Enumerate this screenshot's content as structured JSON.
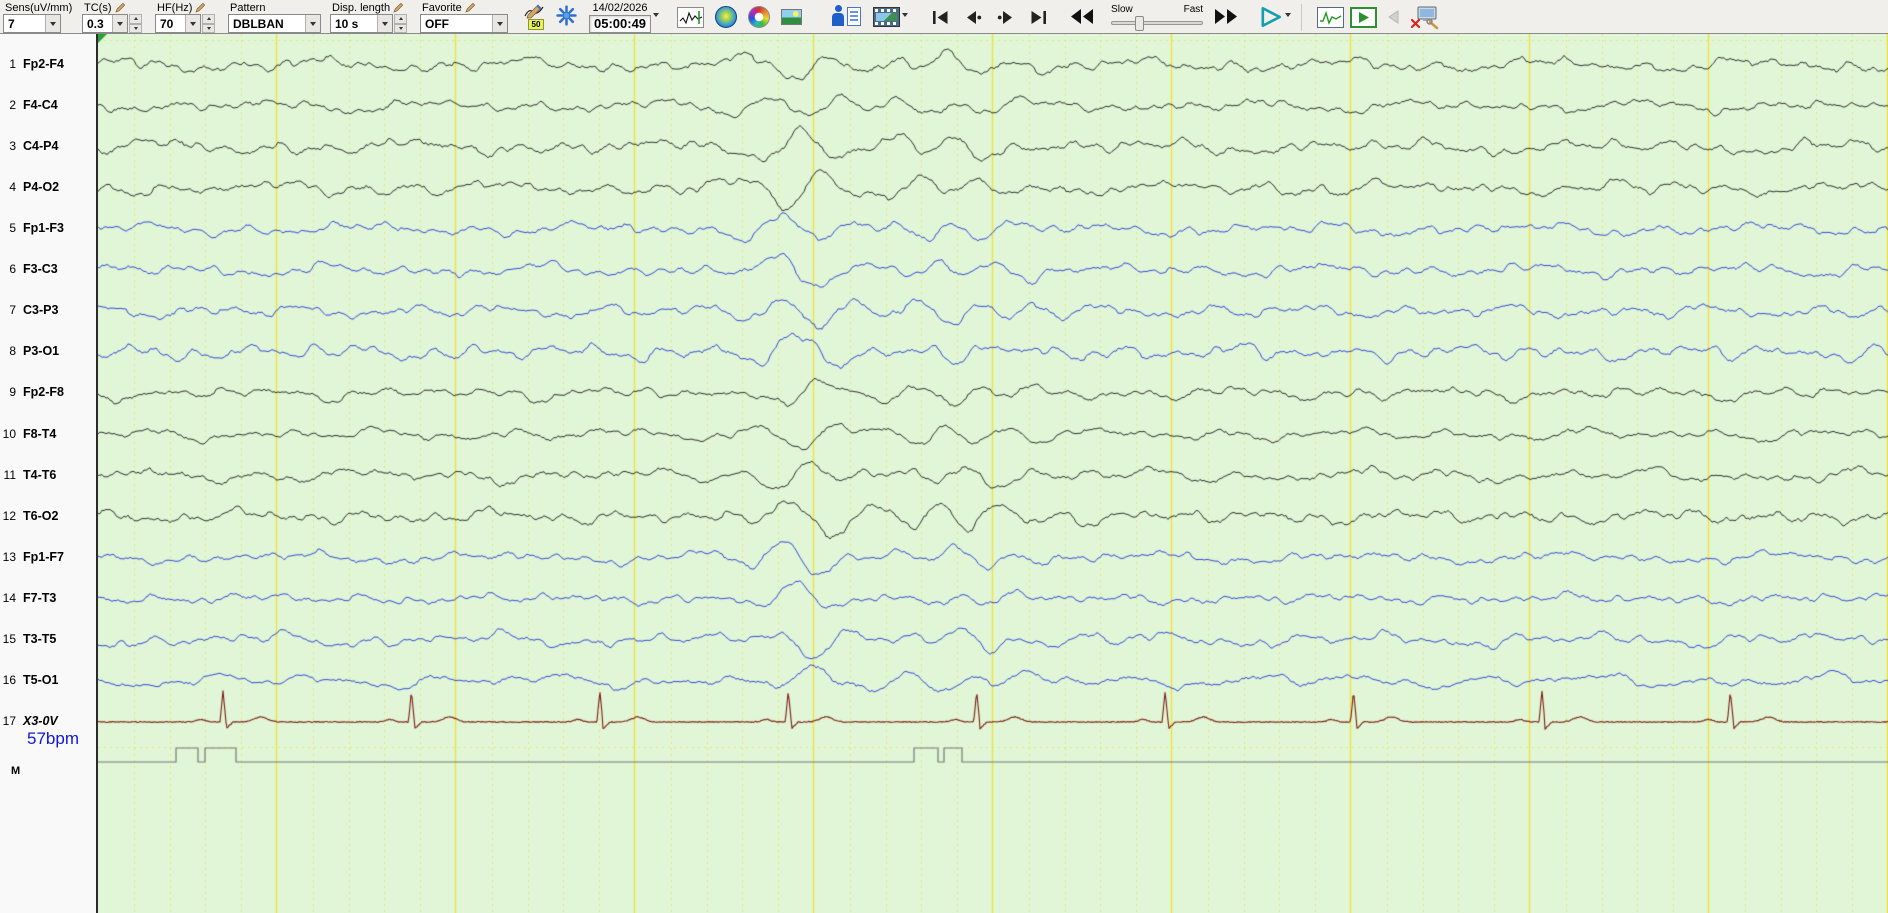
{
  "toolbar": {
    "sens": {
      "label": "Sens(uV/mm)",
      "value": "7"
    },
    "tc": {
      "label": "TC(s)",
      "value": "0.3"
    },
    "hf": {
      "label": "HF(Hz)",
      "value": "70"
    },
    "pattern": {
      "label": "Pattern",
      "value": "DBLBAN"
    },
    "disp": {
      "label": "Disp. length",
      "value": "10 s"
    },
    "favorite": {
      "label": "Favorite",
      "value": "OFF"
    },
    "notch_badge": "50",
    "date": "14/02/2026",
    "time": "05:00:49",
    "slow": "Slow",
    "fast": "Fast"
  },
  "display": {
    "seconds": 10,
    "bg": "#e0f6d7",
    "grid_major": "#eee23c",
    "grid_minor": "#e9e375",
    "eeg_black": "#1a1a1a",
    "eeg_blue": "#2336d6",
    "ecg_color": "#7e1c10",
    "marker_color": "#777777",
    "heart_rate_bpm": 57
  },
  "channels": [
    {
      "num": "1",
      "label": "Fp2-F4",
      "pen": "black",
      "amp": 1.0,
      "burst": 0.9
    },
    {
      "num": "2",
      "label": "F4-C4",
      "pen": "black",
      "amp": 0.9,
      "burst": 0.85
    },
    {
      "num": "3",
      "label": "C4-P4",
      "pen": "black",
      "amp": 1.0,
      "burst": 1.3
    },
    {
      "num": "4",
      "label": "P4-O2",
      "pen": "black",
      "amp": 1.0,
      "burst": 1.5
    },
    {
      "num": "5",
      "label": "Fp1-F3",
      "pen": "blue",
      "amp": 0.9,
      "burst": 1.0
    },
    {
      "num": "6",
      "label": "F3-C3",
      "pen": "blue",
      "amp": 0.85,
      "burst": 1.1
    },
    {
      "num": "7",
      "label": "C3-P3",
      "pen": "blue",
      "amp": 0.9,
      "burst": 1.2
    },
    {
      "num": "8",
      "label": "P3-O1",
      "pen": "blue",
      "amp": 1.0,
      "burst": 1.2
    },
    {
      "num": "9",
      "label": "Fp2-F8",
      "pen": "black",
      "amp": 0.9,
      "burst": 1.0
    },
    {
      "num": "10",
      "label": "F8-T4",
      "pen": "black",
      "amp": 0.85,
      "burst": 1.0
    },
    {
      "num": "11",
      "label": "T4-T6",
      "pen": "black",
      "amp": 0.9,
      "burst": 1.1
    },
    {
      "num": "12",
      "label": "T6-O2",
      "pen": "black",
      "amp": 1.0,
      "burst": 1.4
    },
    {
      "num": "13",
      "label": "Fp1-F7",
      "pen": "blue",
      "amp": 0.9,
      "burst": 1.3
    },
    {
      "num": "14",
      "label": "F7-T3",
      "pen": "blue",
      "amp": 0.8,
      "burst": 0.9
    },
    {
      "num": "15",
      "label": "T3-T5",
      "pen": "blue",
      "amp": 0.85,
      "burst": 1.1
    },
    {
      "num": "16",
      "label": "T5-O1",
      "pen": "blue",
      "amp": 0.9,
      "burst": 1.2
    },
    {
      "num": "17",
      "label": "X3-0V",
      "pen": "ecg",
      "bpm": "57bpm"
    }
  ],
  "marker_row": {
    "label": "M"
  }
}
